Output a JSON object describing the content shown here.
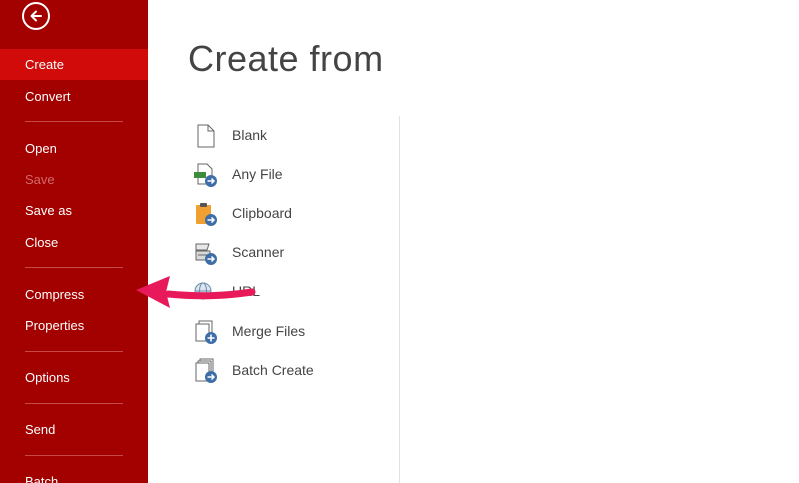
{
  "sidebar": {
    "items": [
      {
        "label": "Create"
      },
      {
        "label": "Convert"
      },
      {
        "label": "Open"
      },
      {
        "label": "Save"
      },
      {
        "label": "Save as"
      },
      {
        "label": "Close"
      },
      {
        "label": "Compress"
      },
      {
        "label": "Properties"
      },
      {
        "label": "Options"
      },
      {
        "label": "Send"
      },
      {
        "label": "Batch"
      }
    ]
  },
  "main": {
    "title": "Create from",
    "options": [
      {
        "label": "Blank",
        "icon": "blank-document-icon"
      },
      {
        "label": "Any File",
        "icon": "any-file-icon"
      },
      {
        "label": "Clipboard",
        "icon": "clipboard-icon"
      },
      {
        "label": "Scanner",
        "icon": "scanner-icon"
      },
      {
        "label": "URL",
        "icon": "globe-icon"
      },
      {
        "label": "Merge Files",
        "icon": "merge-files-icon"
      },
      {
        "label": "Batch Create",
        "icon": "batch-create-icon"
      }
    ]
  },
  "colors": {
    "sidebar_bg": "#a30000",
    "sidebar_active": "#d10a0a",
    "annotation_arrow": "#e8195a",
    "icon_blue": "#3d6ea8",
    "icon_green": "#3c8c3c",
    "icon_orange": "#f0a030"
  }
}
